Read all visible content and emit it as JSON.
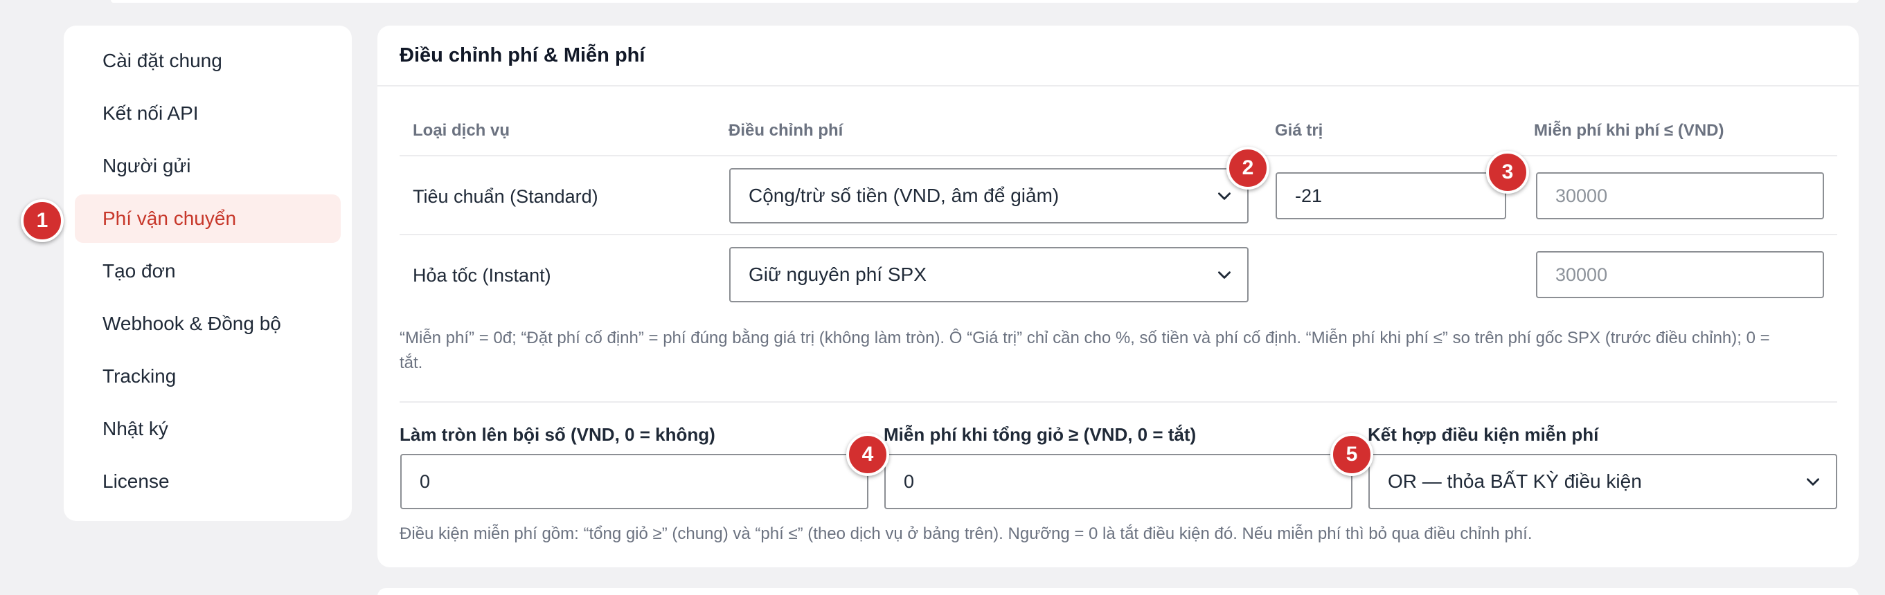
{
  "sidebar": {
    "items": [
      {
        "label": "Cài đặt chung"
      },
      {
        "label": "Kết nối API"
      },
      {
        "label": "Người gửi"
      },
      {
        "label": "Phí vận chuyển"
      },
      {
        "label": "Tạo đơn"
      },
      {
        "label": "Webhook & Đồng bộ"
      },
      {
        "label": "Tracking"
      },
      {
        "label": "Nhật ký"
      },
      {
        "label": "License"
      }
    ],
    "active_index": 3
  },
  "card": {
    "title": "Điều chỉnh phí & Miễn phí",
    "columns": {
      "service": "Loại dịch vụ",
      "adjust": "Điều chỉnh phí",
      "value": "Giá trị",
      "free_when": "Miễn phí khi phí ≤ (VND)"
    },
    "rows": [
      {
        "service": "Tiêu chuẩn (Standard)",
        "adjust": "Cộng/trừ số tiền (VND, âm để giảm)",
        "value": "-21",
        "free_when_placeholder": "30000"
      },
      {
        "service": "Hỏa tốc (Instant)",
        "adjust": "Giữ nguyên phí SPX",
        "free_when_placeholder": "30000"
      }
    ],
    "table_note_line1": "“Miễn phí” = 0đ; “Đặt phí cố định” = phí đúng bằng giá trị (không làm tròn). Ô “Giá trị” chỉ cần cho %, số tiền và phí cố định. “Miễn phí khi phí ≤” so trên phí gốc SPX (trước điều chỉnh); 0 =",
    "table_note_line2": "tắt.",
    "rounding": {
      "label": "Làm tròn lên bội số (VND, 0 = không)",
      "value": "0"
    },
    "cart_free": {
      "label": "Miễn phí khi tổng giỏ ≥ (VND, 0 = tắt)",
      "value": "0"
    },
    "combine": {
      "label": "Kết hợp điều kiện miễn phí",
      "value": "OR — thỏa BẤT KỲ điều kiện"
    },
    "bottom_note": "Điều kiện miễn phí gồm: “tổng giỏ ≥” (chung) và “phí ≤” (theo dịch vụ ở bảng trên). Ngưỡng = 0 là tắt điều kiện đó. Nếu miễn phí thì bỏ qua điều chỉnh phí."
  },
  "badges": [
    "1",
    "2",
    "3",
    "4",
    "5"
  ],
  "colors": {
    "accent": "#c7372a",
    "active_bg": "#fdeeec",
    "badge": "#d32f2f"
  },
  "icons": {
    "select_arrow": "chevron-down-icon"
  }
}
